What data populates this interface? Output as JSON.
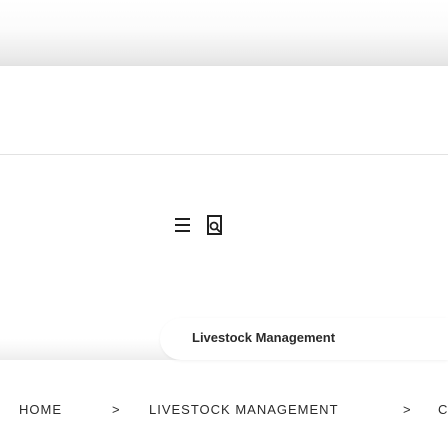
{
  "subheader": {
    "title": "Livestock Management"
  },
  "breadcrumb": {
    "home": "HOME",
    "separator": ">",
    "section": "LIVESTOCK MANAGEMENT",
    "current": "C"
  },
  "icons": {
    "menu": "hamburger-menu-icon",
    "search": "search-icon"
  },
  "colors": {
    "text": "#2a2a2a",
    "icon": "#1f1f1f",
    "divider": "#e2e2e2"
  }
}
